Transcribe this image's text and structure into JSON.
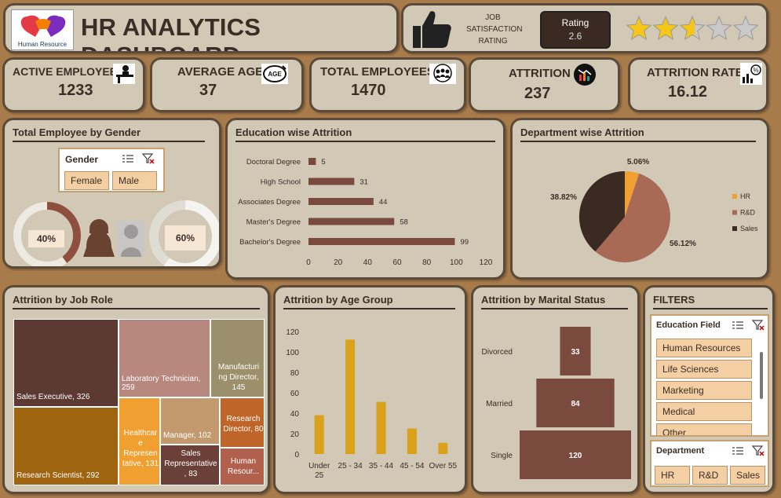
{
  "header": {
    "logo_text": "Human Resource",
    "title": "HR ANALYTICS DASHBOARD",
    "job_sat_label": [
      "JOB",
      "SATISFACTION",
      "RATING"
    ],
    "rating_label": "Rating",
    "rating_value": "2.6",
    "stars_filled": 2.6,
    "stars_total": 5
  },
  "kpis": [
    {
      "label": "ACTIVE EMPLOYEES",
      "value": "1233",
      "icon": "desk-worker-icon"
    },
    {
      "label": "AVERAGE AGE",
      "value": "37",
      "icon": "age-badge-icon"
    },
    {
      "label": "TOTAL EMPLOYEES",
      "value": "1470",
      "icon": "team-icon"
    },
    {
      "label": "ATTRITION",
      "value": "237",
      "icon": "chart-down-icon"
    },
    {
      "label": "ATTRITION RATE",
      "value": "16.12",
      "icon": "percent-chart-icon"
    }
  ],
  "gender": {
    "title": "Total Employee by Gender",
    "slicer_title": "Gender",
    "options": [
      "Female",
      "Male"
    ],
    "female_pct_label": "40%",
    "male_pct_label": "60%",
    "female_pct": 40,
    "male_pct": 60
  },
  "education": {
    "title": "Education wise Attrition",
    "chart_data": {
      "type": "bar",
      "orientation": "horizontal",
      "categories": [
        "Doctoral Degree",
        "High School",
        "Associates Degree",
        "Master's Degree",
        "Bachelor's Degree"
      ],
      "values": [
        5,
        31,
        44,
        58,
        99
      ],
      "xlim": [
        0,
        120
      ],
      "ticks": [
        "0",
        "20",
        "40",
        "60",
        "80",
        "100",
        "120"
      ],
      "color": "#7b4a3e"
    }
  },
  "department": {
    "title": "Department wise Attrition",
    "chart_data": {
      "type": "pie",
      "categories": [
        "HR",
        "R&D",
        "Sales"
      ],
      "values": [
        5.06,
        56.12,
        38.82
      ],
      "labels": [
        "5.06%",
        "56.12%",
        "38.82%"
      ],
      "colors": [
        "#f0a030",
        "#a86a55",
        "#3a2a22"
      ],
      "legend": "right"
    }
  },
  "jobrole": {
    "title": "Attrition by Job Role",
    "chart_data": {
      "type": "treemap",
      "items": [
        {
          "label": "Sales Executive, 326",
          "value": 326,
          "color": "#5c3a33"
        },
        {
          "label": "Research Scientist, 292",
          "value": 292,
          "color": "#9e6410"
        },
        {
          "label": "Laboratory Technician, 259",
          "value": 259,
          "color": "#b8877e"
        },
        {
          "label": "Manufacturing Director, 145",
          "value": 145,
          "color": "#9c8f6c"
        },
        {
          "label": "Healthcare Representative, 131",
          "value": 131,
          "color": "#f0a030"
        },
        {
          "label": "Manager, 102",
          "value": 102,
          "color": "#c39a6e"
        },
        {
          "label": "Research Director, 80",
          "value": 80,
          "color": "#c0652a"
        },
        {
          "label": "Sales Representative, 83",
          "value": 83,
          "color": "#6a4038"
        },
        {
          "label": "Human Resour...",
          "value": 0,
          "color": "#b1604e"
        }
      ],
      "display": {
        "lab": "Laboratory Technician, 259",
        "mfg": "Manufacturi ng Director, 145",
        "hc": "Healthcar e Represen tative, 131",
        "mgr": "Manager, 102",
        "rd": "Research Director, 80",
        "srep": "Sales Representative , 83",
        "hr": "Human Resour..."
      }
    }
  },
  "age": {
    "title": "Attrition by Age Group",
    "chart_data": {
      "type": "bar",
      "categories": [
        "Under 25",
        "25 - 34",
        "35 - 44",
        "45 - 54",
        "Over 55"
      ],
      "values": [
        38,
        112,
        51,
        25,
        11
      ],
      "ylim": [
        0,
        120
      ],
      "ticks": [
        "0",
        "20",
        "40",
        "60",
        "80",
        "100",
        "120"
      ],
      "color": "#d9a21a"
    }
  },
  "marital": {
    "title": "Attrition by Marital Status",
    "chart_data": {
      "type": "bar",
      "orientation": "funnel",
      "categories": [
        "Divorced",
        "Married",
        "Single"
      ],
      "values": [
        33,
        84,
        120
      ],
      "color": "#7b4a3e"
    }
  },
  "filters": {
    "title": "FILTERS",
    "edu_title": "Education Field",
    "edu_options": [
      "Human Resources",
      "Life Sciences",
      "Marketing",
      "Medical",
      "Other"
    ],
    "dept_title": "Department",
    "dept_options": [
      "HR",
      "R&D",
      "Sales"
    ]
  }
}
